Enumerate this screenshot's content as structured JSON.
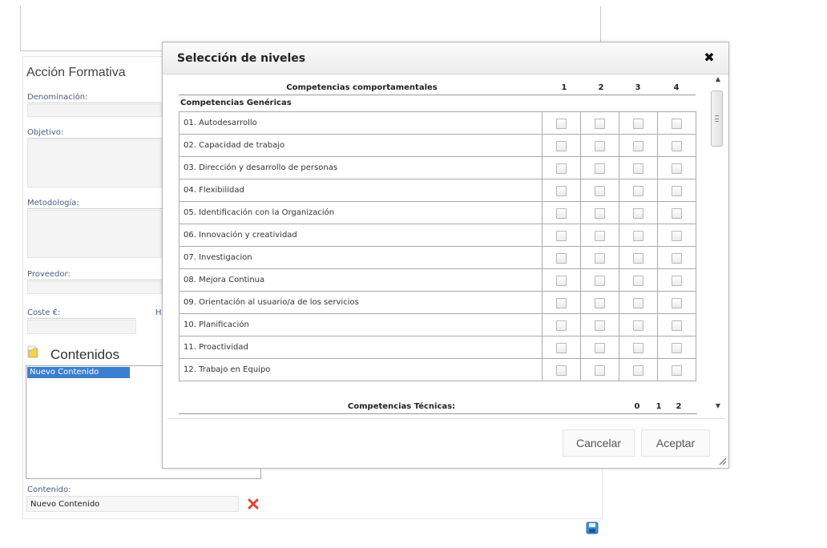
{
  "form": {
    "title": "Acción Formativa",
    "labels": {
      "denominacion": "Denominación:",
      "objetivo": "Objetivo:",
      "metodologia": "Metodología:",
      "proveedor": "Proveedor:",
      "coste": "Coste €:",
      "h_partial": "H"
    },
    "contenidos": {
      "title": "Contenidos",
      "items": [
        "Nuevo Contenido"
      ],
      "contenido_label": "Contenido:",
      "contenido_value": "Nuevo Contenido"
    },
    "icons": {
      "folder": "folder-icon",
      "delete": "delete-x-icon",
      "save": "save-disk-icon"
    }
  },
  "dialog": {
    "title": "Selección de niveles",
    "close_icon": "close-x-icon",
    "comportamentales": {
      "header": "Competencias comportamentales",
      "levels": [
        "1",
        "2",
        "3",
        "4"
      ],
      "group": "Competencias Genéricas",
      "rows": [
        "01. Autodesarrollo",
        "02. Capacidad de trabajo",
        "03. Dirección y desarrollo de personas",
        "04. Flexibilidad",
        "05. Identificación con la Organización",
        "06. Innovación y creatividad",
        "07. Investigacion",
        "08. Mejora Continua",
        "09. Orientación al usuario/a de los servicios",
        "10. Planificación",
        "11. Proactividad",
        "12. Trabajo en Equipo"
      ]
    },
    "tecnicas": {
      "header": "Competencias Técnicas:",
      "levels": [
        "0",
        "1",
        "2"
      ]
    },
    "buttons": {
      "cancel": "Cancelar",
      "accept": "Aceptar"
    }
  }
}
